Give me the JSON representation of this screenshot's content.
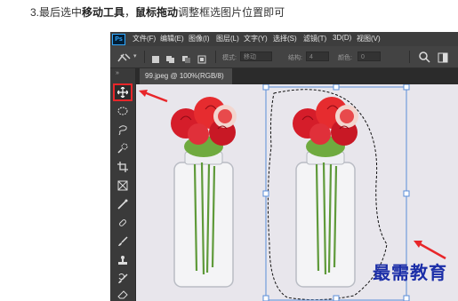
{
  "instruction": {
    "prefix": "3.最后选中",
    "tool_name": "移动工具",
    "comma": "，",
    "action": "鼠标拖动",
    "suffix": "调整框选图片位置即可"
  },
  "app": {
    "logo": "Ps",
    "menu": [
      "文件(F)",
      "编辑(E)",
      "图像(I)",
      "图层(L)",
      "文字(Y)",
      "选择(S)",
      "滤镜(T)",
      "3D(D)",
      "视图(V)"
    ]
  },
  "options_bar": {
    "mode_label": "模式:",
    "mode_value": "移动",
    "structure_label": "结构:",
    "structure_value": "4",
    "color_label": "颜色:",
    "color_value": "0"
  },
  "toolbar": {
    "collapse": "»",
    "tools": [
      "move",
      "elliptical-marquee",
      "lasso",
      "quick-selection",
      "crop",
      "frame",
      "eyedropper",
      "spot-healing",
      "brush",
      "clone-stamp",
      "history-brush",
      "eraser"
    ]
  },
  "document": {
    "tab_title": "99.jpeg @ 100%(RGB/8)"
  },
  "watermark": "最需教育",
  "colors": {
    "annotation_red": "#e8262a",
    "selection_blue": "#5a8ed8",
    "watermark_blue": "#1b2ea8"
  }
}
